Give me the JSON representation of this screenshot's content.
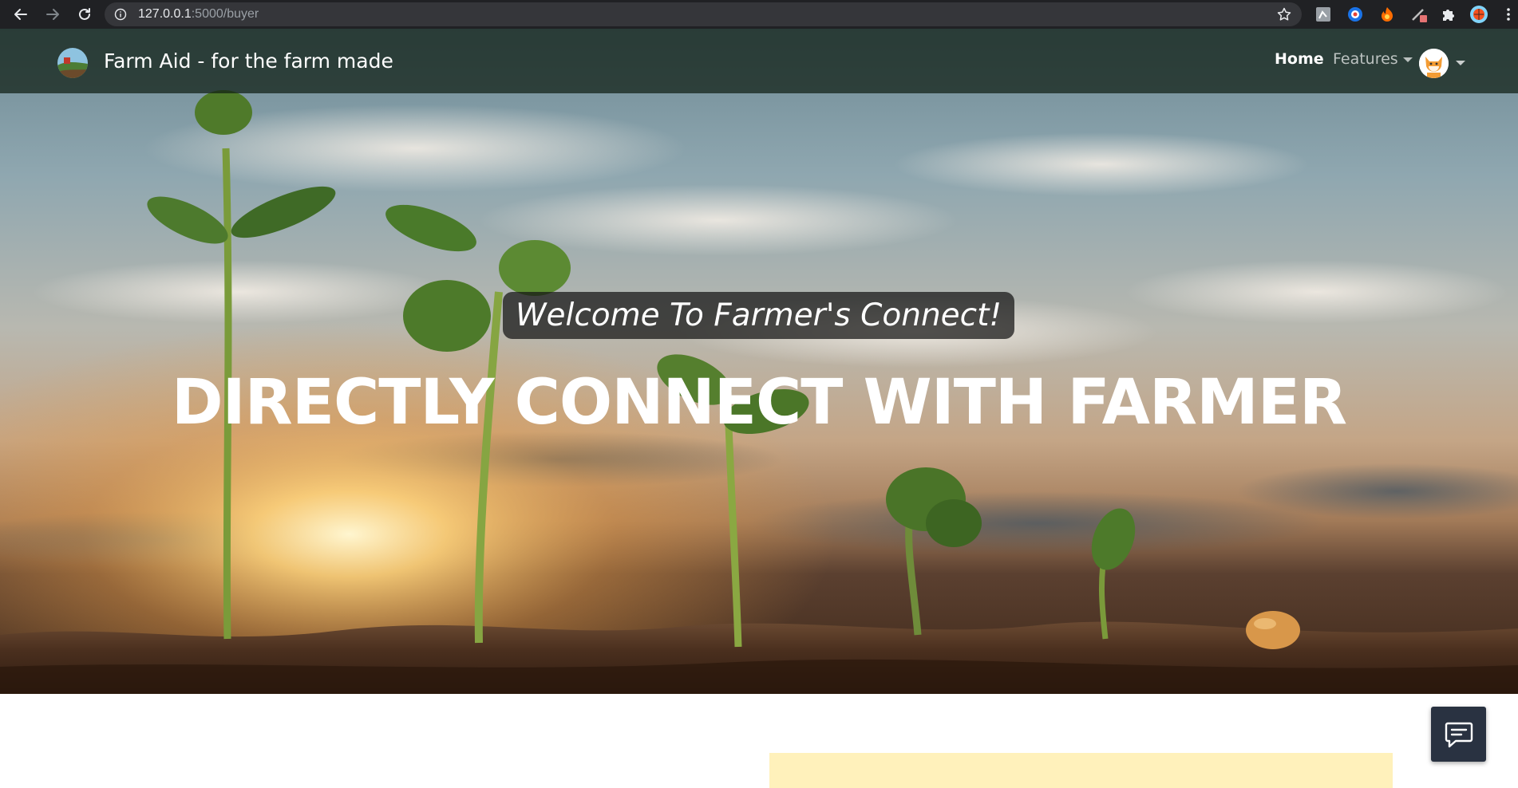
{
  "browser": {
    "url_host": "127.0.0.1",
    "url_path": ":5000/buyer",
    "icons": [
      "back-arrow-icon",
      "forward-arrow-icon",
      "reload-icon",
      "site-info-icon",
      "bookmark-star-icon",
      "extension-icon",
      "profile-icon",
      "kebab-menu-icon"
    ]
  },
  "navbar": {
    "brand": "Farm Aid - for the farm made",
    "home": "Home",
    "features": "Features"
  },
  "hero": {
    "welcome": "Welcome To Farmer's Connect!",
    "headline": "DIRECTLY CONNECT WITH FARMER"
  },
  "colors": {
    "chrome": "#202124",
    "omnibox": "#35363a",
    "navbar_overlay": "#0f1e14",
    "welcome_box": "#141414",
    "yellow_panel": "#fff1bb",
    "chat_button": "#293241"
  }
}
